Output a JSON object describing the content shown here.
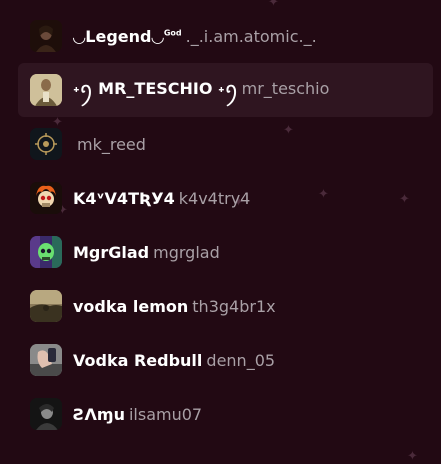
{
  "members": [
    {
      "display_name": "◡Legend◡",
      "display_suffix": "God",
      "username": "._.i.am.atomic._.",
      "avatar": {
        "icon": "dark-portrait-icon",
        "bg": "#2a1410"
      }
    },
    {
      "display_name": "˖ꪆ MR_TESCHIO ˖ꪆ",
      "username": "mr_teschio",
      "avatar": {
        "icon": "character-portrait-icon",
        "bg": "#c8b48a"
      }
    },
    {
      "display_name": "",
      "username": "mk_reed",
      "avatar": {
        "icon": "compass-emblem-icon",
        "bg": "#10161c"
      }
    },
    {
      "display_name": "K4ᵛV4TƦУ4",
      "username": "k4v4try4",
      "avatar": {
        "icon": "flaming-skull-icon",
        "bg": "#1a0d0a"
      }
    },
    {
      "display_name": "MgrGlad",
      "username": "mgrglad",
      "avatar": {
        "icon": "green-skull-icon",
        "bg": "#3a2a6a"
      }
    },
    {
      "display_name": "vodka lemon",
      "username": "th3g4br1x",
      "avatar": {
        "icon": "landscape-photo-icon",
        "bg": "#5a4a30"
      }
    },
    {
      "display_name": "Vodka Redbull",
      "username": "denn_05",
      "avatar": {
        "icon": "hand-photo-icon",
        "bg": "#6a6a6a"
      }
    },
    {
      "display_name": "ƧΛɱu",
      "username": "ilsamu07",
      "avatar": {
        "icon": "bw-portrait-icon",
        "bg": "#1a1a1a"
      }
    }
  ]
}
